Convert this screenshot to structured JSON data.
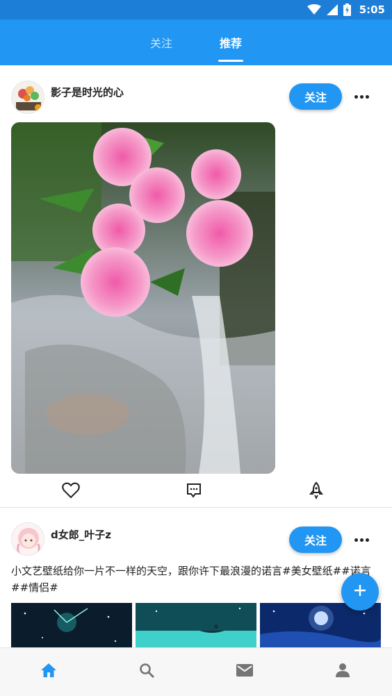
{
  "status_bar": {
    "time": "5:05",
    "icons": [
      "wifi-icon",
      "cellular-signal-icon",
      "battery-charging-icon"
    ]
  },
  "header": {
    "tabs": [
      {
        "label": "关注",
        "active": false
      },
      {
        "label": "推荐",
        "active": true
      }
    ]
  },
  "posts": [
    {
      "username": "影子是时光的心",
      "follow_label": "关注",
      "media": "flowers-waterfall-image",
      "actions": [
        "heart-icon",
        "comment-icon",
        "rocket-icon"
      ]
    },
    {
      "username": "d女郎_叶子z",
      "follow_label": "关注",
      "text": "小文艺壁纸给你一片不一样的天空，跟你许下最浪漫的诺言#美女壁纸##诺言##情侣#",
      "thumbnails": [
        "starry-sky-thumbnail",
        "boat-on-sea-thumbnail",
        "moon-night-thumbnail"
      ]
    }
  ],
  "fab": {
    "icon": "plus-icon"
  },
  "bottom_nav": {
    "items": [
      "home-icon",
      "search-icon",
      "mail-icon",
      "person-icon"
    ],
    "active_color": "#2196f3",
    "inactive_color": "#757575"
  },
  "colors": {
    "primary": "#2196f3",
    "status_bar": "#1c7ed6"
  }
}
